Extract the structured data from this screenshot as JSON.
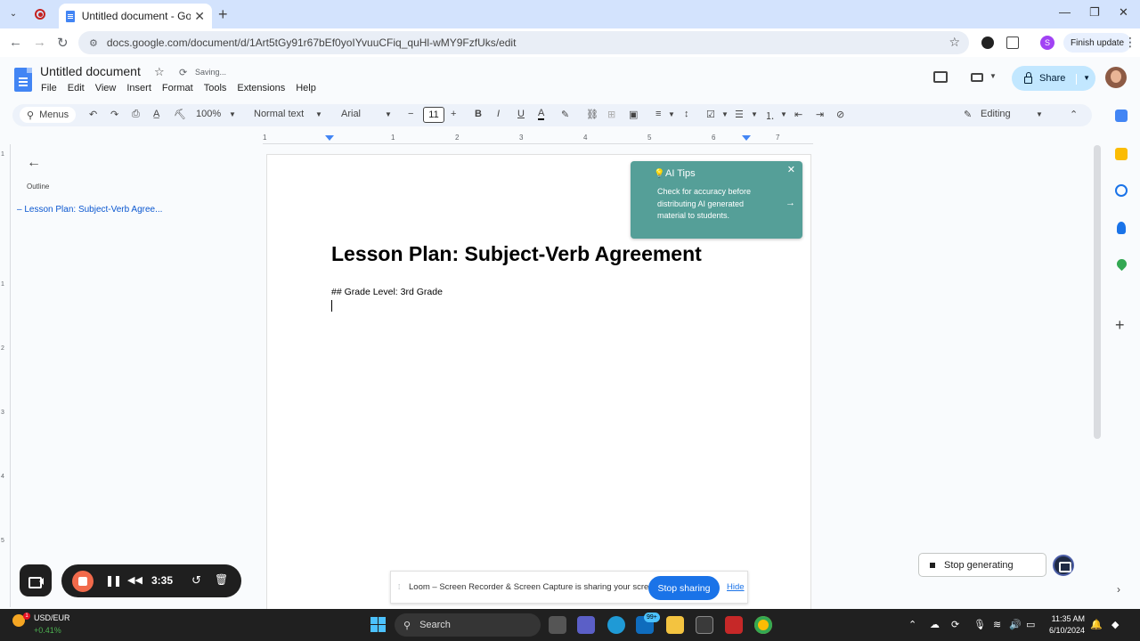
{
  "browser": {
    "tab_title": "Untitled document - Google Do",
    "url": "docs.google.com/document/d/1Art5tGy91r67bEf0yoIYvuuCFiq_quHl-wMY9FzfUks/edit",
    "profile_initial": "S",
    "finish_update_label": "Finish update"
  },
  "docs": {
    "title": "Untitled document",
    "save_status": "Saving...",
    "menu": [
      "File",
      "Edit",
      "View",
      "Insert",
      "Format",
      "Tools",
      "Extensions",
      "Help"
    ],
    "share_label": "Share",
    "toolbar": {
      "menus_label": "Menus",
      "zoom": "100%",
      "style": "Normal text",
      "font": "Arial",
      "font_size": "11",
      "mode": "Editing"
    },
    "ruler_numbers": [
      "1",
      "1",
      "2",
      "3",
      "4",
      "5",
      "6",
      "7"
    ],
    "vruler_numbers": [
      "1",
      "1",
      "2",
      "3",
      "4",
      "5"
    ],
    "outline": {
      "label": "Outline",
      "item": "Lesson Plan: Subject-Verb Agree..."
    },
    "content": {
      "heading": "Lesson Plan: Subject-Verb Agreement",
      "line1": "## Grade Level: 3rd Grade"
    }
  },
  "ai_tips": {
    "title": "AI Tips",
    "body": "Check for accuracy before distributing AI generated material to students."
  },
  "stop_generating_label": "Stop generating",
  "loom": {
    "timer": "3:35",
    "share_message": "Loom – Screen Recorder & Screen Capture is sharing your screen.",
    "stop_sharing_label": "Stop sharing",
    "hide_label": "Hide"
  },
  "taskbar": {
    "weather_badge": "1",
    "ticker_symbol": "USD/EUR",
    "ticker_change": "+0.41%",
    "search_placeholder": "Search",
    "mail_badge": "99+",
    "time": "11:35 AM",
    "date": "6/10/2024"
  },
  "colors": {
    "ai_tips_bg": "#559f98",
    "share_bg": "#c2e7ff",
    "loom_stop": "#f16a4b",
    "stop_sharing_btn": "#1a73e8"
  }
}
